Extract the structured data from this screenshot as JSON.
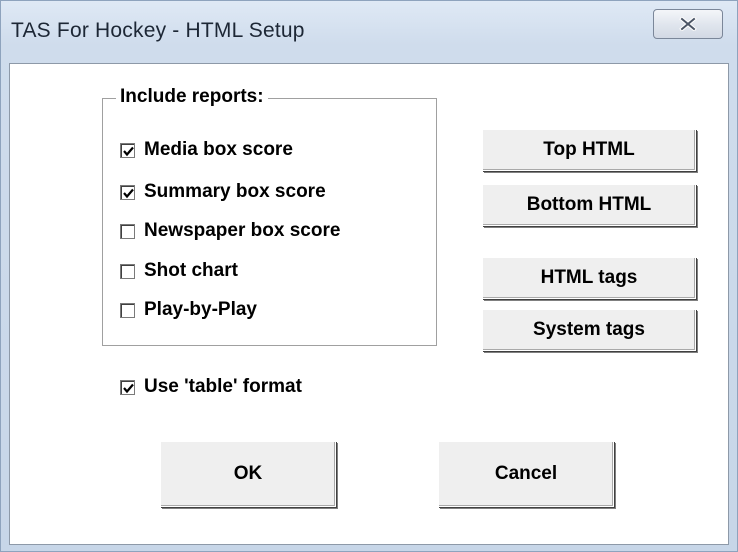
{
  "window": {
    "title": "TAS For Hockey - HTML Setup"
  },
  "reports_group": {
    "title": "Include reports:",
    "items": [
      {
        "label": "Media box score",
        "checked": true
      },
      {
        "label": "Summary box score",
        "checked": true
      },
      {
        "label": "Newspaper box score",
        "checked": false
      },
      {
        "label": "Shot chart",
        "checked": false
      },
      {
        "label": "Play-by-Play",
        "checked": false
      }
    ]
  },
  "table_format": {
    "label": "Use 'table' format",
    "checked": true
  },
  "side_buttons": {
    "top_html": "Top HTML",
    "bottom_html": "Bottom HTML",
    "html_tags": "HTML tags",
    "system_tags": "System tags"
  },
  "footer_buttons": {
    "ok": "OK",
    "cancel": "Cancel"
  },
  "icons": {
    "close": "close-x-icon",
    "check": "checkmark-icon"
  }
}
